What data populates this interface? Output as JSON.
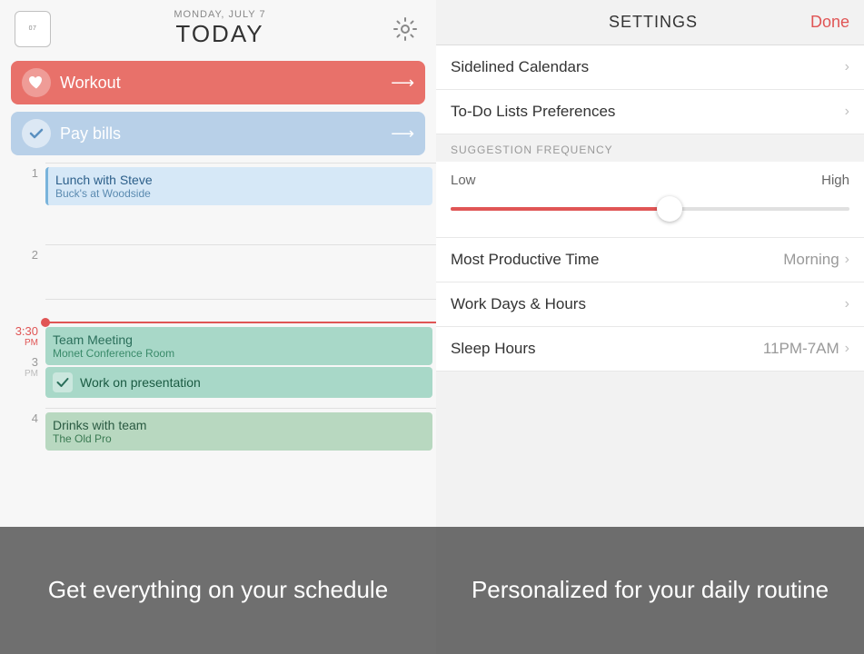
{
  "left": {
    "header": {
      "cal_num": "07",
      "date_text": "MONDAY, JULY 7",
      "today_text": "TODAY"
    },
    "tasks": [
      {
        "label": "Workout",
        "type": "red",
        "icon": "♥"
      },
      {
        "label": "Pay bills",
        "type": "blue",
        "icon": "✓"
      }
    ],
    "time_slots": [
      {
        "hour": "1",
        "ampm": "",
        "event": {
          "title": "Lunch with Steve",
          "subtitle": "Buck's at Woodside",
          "type": "blue"
        }
      },
      {
        "hour": "2",
        "ampm": "",
        "event": null
      },
      {
        "hour": "3",
        "ampm": "PM",
        "current_time": "3:30",
        "current_ampm": "PM",
        "events": [
          {
            "title": "Team Meeting",
            "subtitle": "Monet Conference Room",
            "type": "teal"
          },
          {
            "title": "Work on presentation",
            "type": "todo"
          }
        ]
      },
      {
        "hour": "4",
        "ampm": "",
        "event": {
          "title": "Drinks with team",
          "subtitle": "The Old Pro",
          "type": "teal-light"
        }
      }
    ],
    "bottom_text": "Get everything on your schedule"
  },
  "right": {
    "header": {
      "title": "SETTINGS",
      "done_label": "Done"
    },
    "items": [
      {
        "label": "Sidelined Calendars",
        "value": "",
        "has_chevron": true
      },
      {
        "label": "To-Do Lists Preferences",
        "value": "",
        "has_chevron": true
      }
    ],
    "section_header": "SUGGESTION FREQUENCY",
    "slider": {
      "low_label": "Low",
      "high_label": "High",
      "value": 57
    },
    "items2": [
      {
        "label": "Most Productive Time",
        "value": "Morning",
        "has_chevron": true
      },
      {
        "label": "Work Days & Hours",
        "value": "",
        "has_chevron": true
      },
      {
        "label": "Sleep Hours",
        "value": "11PM-7AM",
        "has_chevron": true
      }
    ],
    "bottom_text": "Personalized for your daily routine"
  }
}
